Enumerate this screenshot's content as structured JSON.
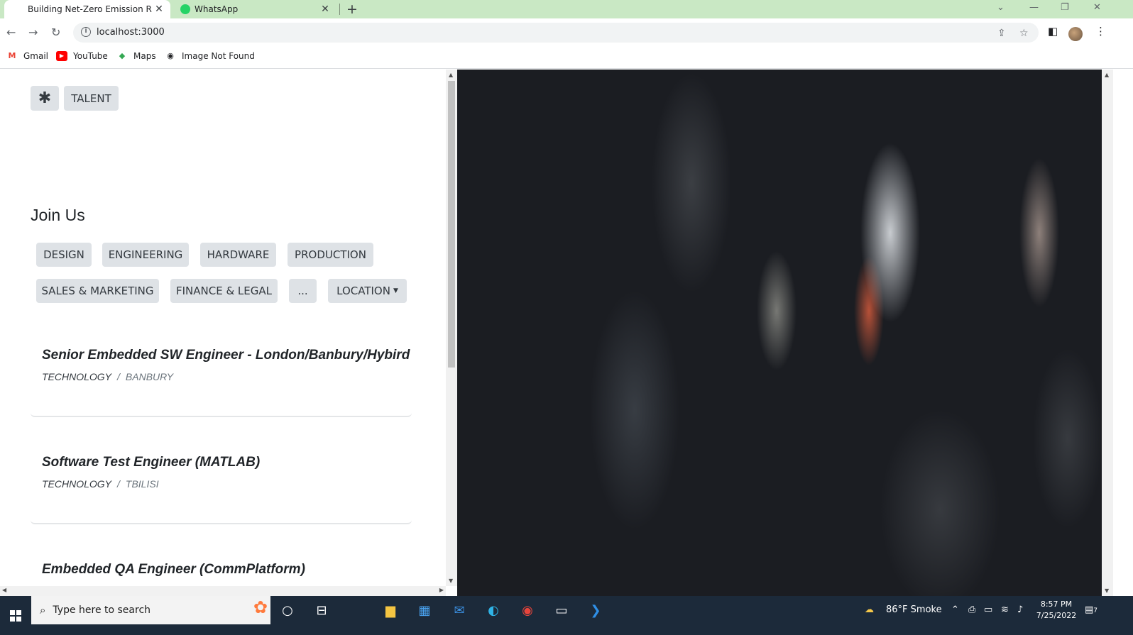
{
  "browser": {
    "tabs": [
      {
        "title": "Building Net-Zero Emission Ride",
        "active": true
      },
      {
        "title": "WhatsApp",
        "active": false
      }
    ],
    "url": "localhost:3000",
    "bookmarks": [
      {
        "label": "Gmail",
        "icon": "gmail-icon"
      },
      {
        "label": "YouTube",
        "icon": "youtube-icon"
      },
      {
        "label": "Maps",
        "icon": "maps-icon"
      },
      {
        "label": "Image Not Found",
        "icon": "globe-icon"
      }
    ]
  },
  "nav": {
    "logo_glyph": "✱",
    "talent_label": "TALENT"
  },
  "join": {
    "title": "Join Us",
    "filters": [
      "DESIGN",
      "ENGINEERING",
      "HARDWARE",
      "PRODUCTION",
      "SALES & MARKETING",
      "FINANCE & LEGAL",
      "...",
      "LOCATION"
    ]
  },
  "jobs": [
    {
      "title": "Senior Embedded SW Engineer - London/Banbury/Hybird",
      "department": "TECHNOLOGY",
      "separator": "/",
      "location": "BANBURY"
    },
    {
      "title": "Software Test Engineer (MATLAB)",
      "department": "TECHNOLOGY",
      "separator": "/",
      "location": "TBILISI"
    },
    {
      "title": "Embedded QA Engineer (CommPlatform)",
      "department": "",
      "separator": "",
      "location": ""
    }
  ],
  "taskbar": {
    "search_placeholder": "Type here to search",
    "weather": "86°F  Smoke",
    "time": "8:57 PM",
    "date": "7/25/2022",
    "notifications": "7"
  },
  "colors": {
    "tabbar": "#c9e8c4",
    "chip_bg": "#dee2e6",
    "hero_bg": "#1b1d22",
    "taskbar": "#1c2a3a"
  }
}
